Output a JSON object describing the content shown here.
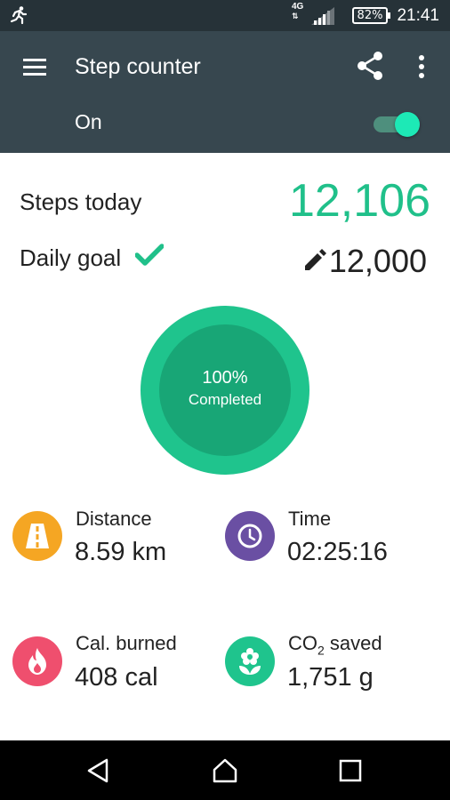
{
  "status_bar": {
    "network": "4G",
    "battery": "82%",
    "time": "21:41"
  },
  "app_bar": {
    "title": "Step counter",
    "toggle_label": "On",
    "toggle_on": true
  },
  "summary": {
    "steps_label": "Steps today",
    "steps_value": "12,106",
    "goal_label": "Daily goal",
    "goal_value": "12,000"
  },
  "progress": {
    "percent_text": "100%",
    "status_text": "Completed",
    "fraction": 1.0
  },
  "stats": {
    "distance": {
      "label": "Distance",
      "value": "8.59 km",
      "icon": "road-icon",
      "color": "#f5a623"
    },
    "time": {
      "label": "Time",
      "value": "02:25:16",
      "icon": "clock-icon",
      "color": "#6a4fa3"
    },
    "calories": {
      "label": "Cal. burned",
      "value": "408 cal",
      "icon": "flame-icon",
      "color": "#ef4f6e"
    },
    "co2": {
      "label_main": "CO",
      "label_sub": "2",
      "label_rest": " saved",
      "value": "1,751 g",
      "icon": "flower-icon",
      "color": "#1fc48d"
    }
  },
  "colors": {
    "status_bar": "#263238",
    "app_bar": "#37474f",
    "accent": "#20c08a",
    "toggle_thumb": "#1de9b6",
    "progress_outer": "#1fc48d",
    "progress_inner": "#18a676"
  }
}
